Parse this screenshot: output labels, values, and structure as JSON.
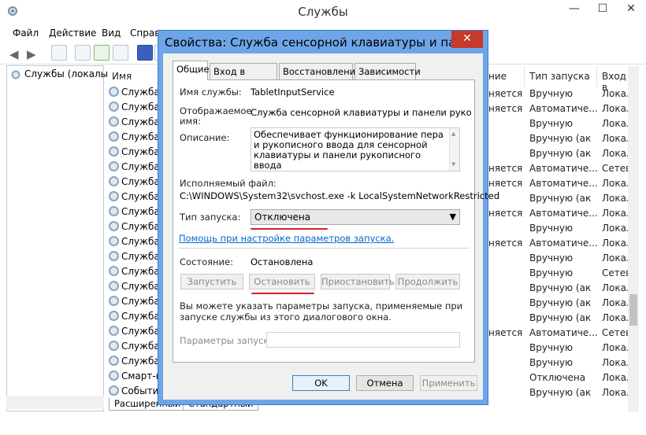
{
  "window": {
    "title": "Службы",
    "minimize": "—",
    "maximize": "☐",
    "close": "✕"
  },
  "menu": [
    "Файл",
    "Действие",
    "Вид",
    "Справ"
  ],
  "left_pane": {
    "root": "Службы (локалы"
  },
  "columns": {
    "name": "Имя",
    "state": "ние",
    "startup": "Тип запуска",
    "logon": "Вход в"
  },
  "rows": [
    {
      "name": "Служба",
      "state": "няется",
      "startup": "Вручную",
      "logon": "Локал"
    },
    {
      "name": "Служба",
      "state": "няется",
      "startup": "Автоматиче...",
      "logon": "Локал"
    },
    {
      "name": "Служба",
      "state": "",
      "startup": "Вручную",
      "logon": "Локал"
    },
    {
      "name": "Служба",
      "state": "",
      "startup": "Вручную (ак",
      "logon": "Локал"
    },
    {
      "name": "Служба",
      "state": "",
      "startup": "Вручную (ак",
      "logon": "Локал"
    },
    {
      "name": "Служба",
      "state": "няется",
      "startup": "Автоматиче...",
      "logon": "Сетев"
    },
    {
      "name": "Служба",
      "state": "няется",
      "startup": "Автоматиче...",
      "logon": "Локал"
    },
    {
      "name": "Служба",
      "state": "",
      "startup": "Вручную (ак",
      "logon": "Локал"
    },
    {
      "name": "Служба",
      "state": "няется",
      "startup": "Автоматиче...",
      "logon": "Локал"
    },
    {
      "name": "Служба",
      "state": "",
      "startup": "Вручную",
      "logon": "Локал"
    },
    {
      "name": "Служба",
      "state": "няется",
      "startup": "Автоматиче...",
      "logon": "Локал"
    },
    {
      "name": "Служба",
      "state": "",
      "startup": "Вручную",
      "logon": "Локал"
    },
    {
      "name": "Служба",
      "state": "",
      "startup": "Вручную",
      "logon": "Сетев"
    },
    {
      "name": "Служба",
      "state": "",
      "startup": "Вручную (ак",
      "logon": "Локал"
    },
    {
      "name": "Служба",
      "state": "",
      "startup": "Вручную (ак",
      "logon": "Локал"
    },
    {
      "name": "Служба",
      "state": "",
      "startup": "Вручную (ак",
      "logon": "Локал"
    },
    {
      "name": "Служба",
      "state": "няется",
      "startup": "Автоматиче...",
      "logon": "Сетев"
    },
    {
      "name": "Служба",
      "state": "",
      "startup": "Вручную",
      "logon": "Локал"
    },
    {
      "name": "Служба",
      "state": "",
      "startup": "Вручную",
      "logon": "Локал"
    },
    {
      "name": "Смарт-к",
      "state": "",
      "startup": "Отключена",
      "logon": "Локал"
    },
    {
      "name": "Событи",
      "state": "",
      "startup": "Вручную (ак",
      "logon": "Локал"
    }
  ],
  "bottom_tabs": [
    "Расширенный",
    "Стандартный"
  ],
  "dialog": {
    "title": "Свойства: Служба сенсорной клавиатуры и панели р...",
    "close": "✕",
    "tabs": [
      "Общие",
      "Вход в систему",
      "Восстановление",
      "Зависимости"
    ],
    "service_name_label": "Имя службы:",
    "service_name": "TabletInputService",
    "display_name_label": "Отображаемое имя:",
    "display_name": "Служба сенсорной клавиатуры и панели рукописного",
    "description_label": "Описание:",
    "description": "Обеспечивает функционирование пера и рукописного ввода для сенсорной клавиатуры и панели рукописного ввода",
    "exe_label": "Исполняемый файл:",
    "exe_path": "C:\\WINDOWS\\System32\\svchost.exe -k LocalSystemNetworkRestricted",
    "startup_type_label": "Тип запуска:",
    "startup_type": "Отключена",
    "help_link": "Помощь при настройке параметров запуска.",
    "status_label": "Состояние:",
    "status": "Остановлена",
    "btn_start": "Запустить",
    "btn_stop": "Остановить",
    "btn_pause": "Приостановить",
    "btn_resume": "Продолжить",
    "hint": "Вы можете указать параметры запуска, применяемые при запуске службы из этого диалогового окна.",
    "params_label": "Параметры запуска:",
    "params_value": "",
    "btn_ok": "OK",
    "btn_cancel": "Отмена",
    "btn_apply": "Применить"
  },
  "colors": {
    "dialog_frame": "#6ea5e8",
    "close_button": "#c7392b",
    "link": "#0066cc",
    "annotation": "#d0232a"
  }
}
